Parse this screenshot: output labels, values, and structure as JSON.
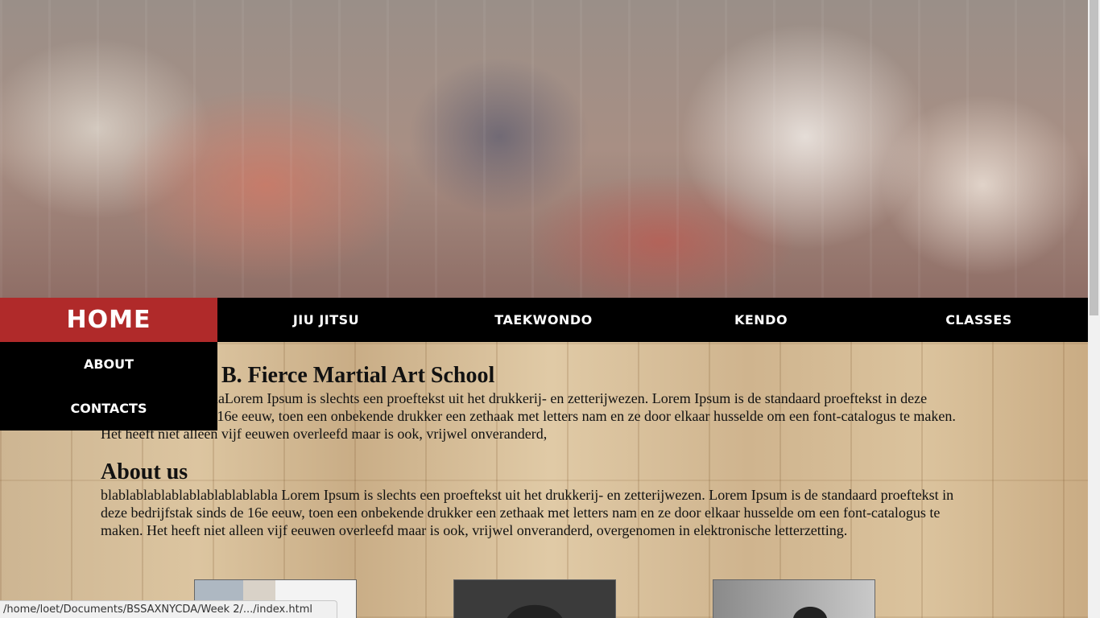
{
  "nav": {
    "items": [
      {
        "label": "Home"
      },
      {
        "label": "Jiu Jitsu"
      },
      {
        "label": "Taekwondo"
      },
      {
        "label": "Kendo"
      },
      {
        "label": "Classes"
      }
    ],
    "dropdown": [
      {
        "label": "About"
      },
      {
        "label": "Contacts"
      }
    ]
  },
  "main": {
    "title": "B. Fierce Martial Art School",
    "intro": "blablablablablablablaLorem Ipsum is slechts een proeftekst uit het drukkerij- en zetterijwezen. Lorem Ipsum is de standaard proeftekst in deze bedrijfstak sinds de 16e eeuw, toen een onbekende drukker een zethaak met letters nam en ze door elkaar husselde om een font-catalogus te maken. Het heeft niet alleen vijf eeuwen overleefd maar is ook, vrijwel onveranderd,",
    "about_title": "About us",
    "about_text": "blablablablablablablablablabla Lorem Ipsum is slechts een proeftekst uit het drukkerij- en zetterijwezen. Lorem Ipsum is de standaard proeftekst in deze bedrijfstak sinds de 16e eeuw, toen een onbekende drukker een zethaak met letters nam en ze door elkaar husselde om een font-catalogus te maken. Het heeft niet alleen vijf eeuwen overleefd maar is ook, vrijwel onveranderd, overgenomen in elektronische letterzetting."
  },
  "status_bar": {
    "url": "/home/loet/Documents/BSSAXNYCDA/Week 2/.../index.html"
  }
}
